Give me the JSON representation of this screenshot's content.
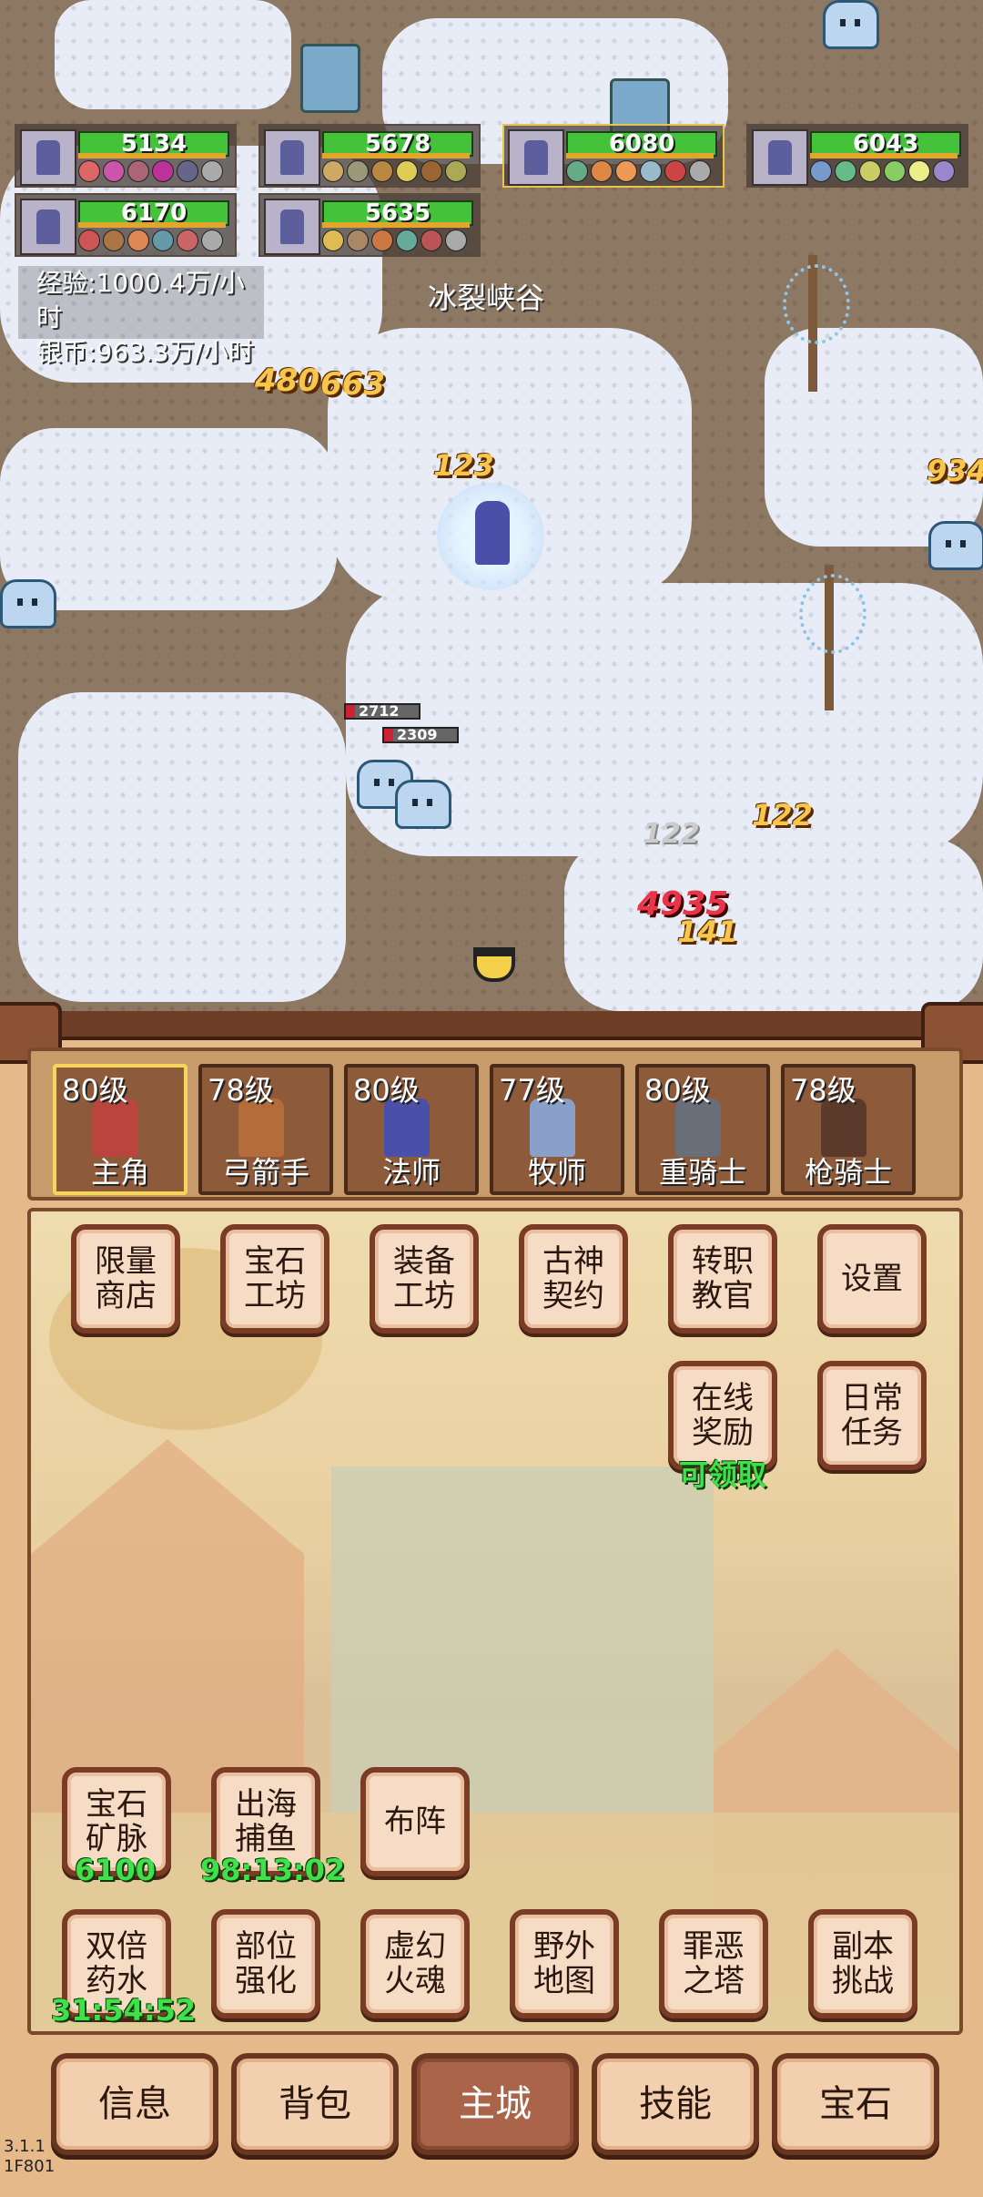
{
  "party": [
    {
      "hp": "5134"
    },
    {
      "hp": "5678"
    },
    {
      "hp": "6080",
      "selected": true
    },
    {
      "hp": "6043"
    },
    {
      "hp": "6170"
    },
    {
      "hp": "5635"
    }
  ],
  "stats": {
    "exp": "经验:1000.4万/小时",
    "silver": "银币:963.3万/小时"
  },
  "map_name": "冰裂峡谷",
  "damage_numbers": [
    "480",
    "663",
    "123",
    "934",
    "122",
    "4935",
    "141",
    "122"
  ],
  "enemy_hp": [
    "2712",
    "2309"
  ],
  "heroes": [
    {
      "level": "80级",
      "role": "主角",
      "active": true
    },
    {
      "level": "78级",
      "role": "弓箭手"
    },
    {
      "level": "80级",
      "role": "法师"
    },
    {
      "level": "77级",
      "role": "牧师"
    },
    {
      "level": "80级",
      "role": "重骑士"
    },
    {
      "level": "78级",
      "role": "枪骑士"
    }
  ],
  "menu": {
    "limited_shop": "限量商店",
    "gem_workshop": "宝石工坊",
    "equip_workshop": "装备工坊",
    "ancient_pact": "古神契约",
    "job_change": "转职教官",
    "settings": "设置",
    "online_reward": "在线奖励",
    "online_reward_status": "可领取",
    "daily_tasks": "日常任务",
    "gem_vein": "宝石矿脉",
    "gem_vein_value": "6100",
    "fishing": "出海捕鱼",
    "fishing_timer": "98:13:02",
    "formation": "布阵",
    "double_potion": "双倍药水",
    "double_potion_timer": "31:54:52",
    "part_enhance": "部位强化",
    "illusion_soul": "虚幻火魂",
    "field_map": "野外地图",
    "tower": "罪恶之塔",
    "dungeon": "副本挑战"
  },
  "nav": {
    "info": "信息",
    "bag": "背包",
    "city": "主城",
    "skills": "技能",
    "gems": "宝石"
  },
  "version": {
    "line1": "3.1.1",
    "line2": "1F801"
  },
  "colors": {
    "hp": "#43c23a",
    "timer_green": "#3fe04a",
    "panel": "#e6b98a",
    "frame": "#7a3c24"
  }
}
